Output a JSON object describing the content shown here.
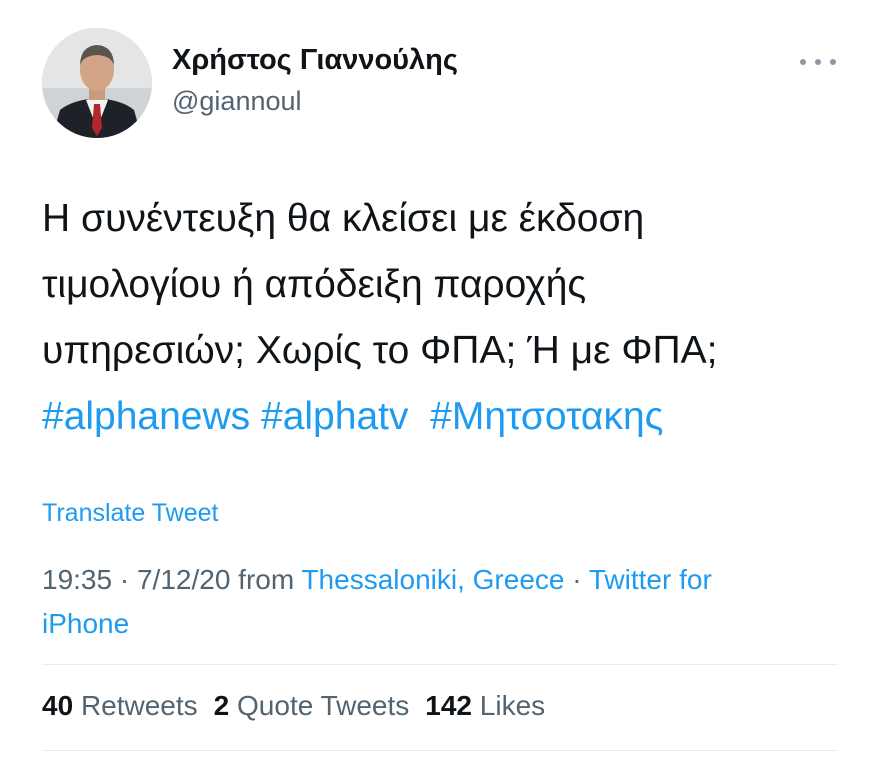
{
  "author": {
    "name": "Χρήστος Γιαννούλης",
    "handle": "@giannoul"
  },
  "tweet": {
    "lines": [
      "Η συνέντευξη θα κλείσει με έκδοση",
      "τιμολογίου ή απόδειξη παροχής",
      "υπηρεσιών; Χωρίς το ΦΠΑ; Ή με ΦΠΑ;"
    ],
    "hashtags": [
      "#alphanews",
      "#alphatv",
      "#Μητσοτακης"
    ]
  },
  "translate_label": "Translate Tweet",
  "meta": {
    "time": "19:35",
    "sep1": " · ",
    "date": "7/12/20",
    "from": " from ",
    "location": "Thessaloniki, Greece",
    "sep2": " · ",
    "source_line1": "Twitter for",
    "source_line2": "iPhone"
  },
  "stats": {
    "retweets_count": "40",
    "retweets_label": "Retweets",
    "quotes_count": "2",
    "quotes_label": "Quote Tweets",
    "likes_count": "142",
    "likes_label": "Likes"
  },
  "icons": {
    "more": "more-options-icon"
  },
  "colors": {
    "link": "#1d9bf0",
    "secondary": "#536471",
    "primary": "#0f1419"
  }
}
